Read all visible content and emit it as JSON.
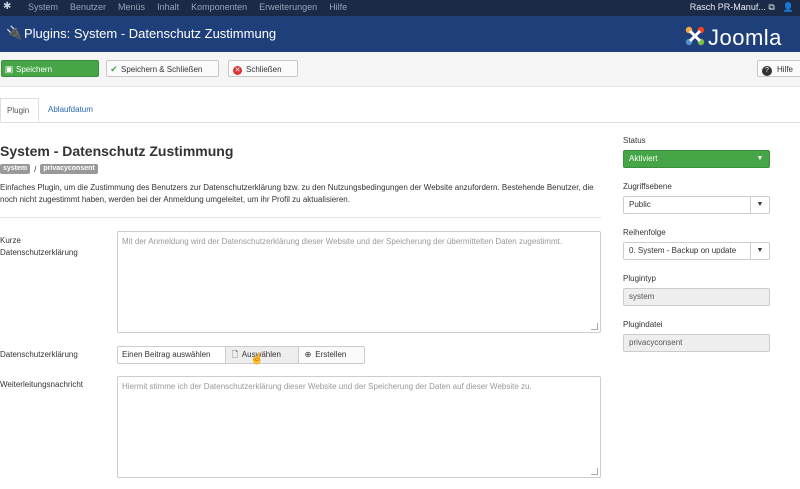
{
  "topnav": {
    "items": [
      "System",
      "Benutzer",
      "Menüs",
      "Inhalt",
      "Komponenten",
      "Erweiterungen",
      "Hilfe"
    ],
    "site_name": "Rasch PR-Manuf...",
    "external_icon": "external-link-icon",
    "user_icon": "user-icon"
  },
  "header": {
    "title": "Plugins: System - Datenschutz Zustimmung",
    "brand": "Joomla",
    "icon": "plug-icon"
  },
  "toolbar": {
    "save_label": "Speichern",
    "save_close_label": "Speichern & Schließen",
    "close_label": "Schließen",
    "help_label": "Hilfe"
  },
  "tabs": [
    {
      "label": "Plugin"
    },
    {
      "label": "Ablaufdatum"
    }
  ],
  "main": {
    "title": "System - Datenschutz Zustimmung",
    "badge_folder": "system",
    "badge_separator": "/",
    "badge_element": "privacyconsent",
    "description": "Einfaches Plugin, um die Zustimmung des Benutzers zur Datenschutzerklärung bzw. zu den Nutzungsbedingungen der Website anzufordern. Bestehende Benutzer, die noch nicht zugestimmt haben, werden bei der Anmeldung umgeleitet, um ihr Profil zu aktualisieren.",
    "fields": {
      "short_privacy_label": "Kurze Datenschutzerklärung",
      "short_privacy_placeholder": "Mit der Anmeldung wird der Datenschutzerklärung dieser Website und der Speicherung der übermittelten Daten zugestimmt.",
      "privacy_label": "Datenschutzerklärung",
      "privacy_select_text": "Einen Beitrag auswählen",
      "privacy_choose_label": "Auswählen",
      "privacy_create_label": "Erstellen",
      "redirect_label": "Weiterleitungsnachricht",
      "redirect_placeholder": "Hiermit stimme ich der Datenschutzerklärung dieser Website und der Speicherung der Daten auf dieser Website zu."
    }
  },
  "sidebar": {
    "status_label": "Status",
    "status_value": "Aktiviert",
    "access_label": "Zugriffsebene",
    "access_value": "Public",
    "ordering_label": "Reihenfolge",
    "ordering_value": "0. System - Backup on update",
    "type_label": "Plugintyp",
    "type_value": "system",
    "file_label": "Plugindatei",
    "file_value": "privacyconsent"
  },
  "colors": {
    "topnav_bg": "#1b2a47",
    "header_bg": "#1e3f7a",
    "success": "#46a546",
    "link": "#2a69b8",
    "danger": "#dd3333"
  }
}
